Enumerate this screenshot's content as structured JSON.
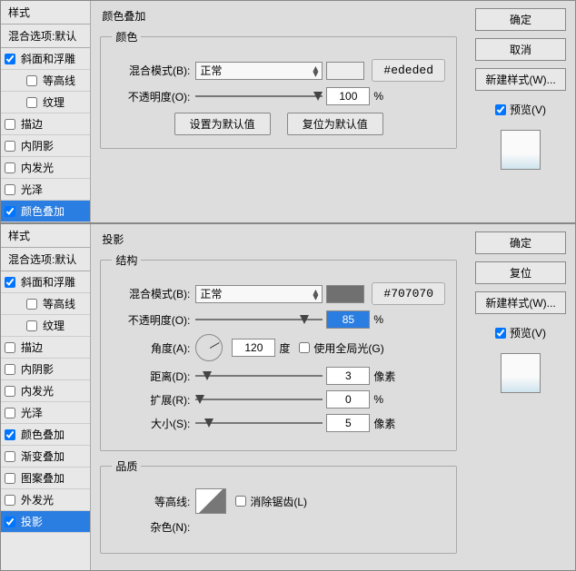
{
  "top": {
    "sidebar": {
      "header": "样式",
      "sub": "混合选项:默认",
      "items": [
        {
          "label": "斜面和浮雕",
          "checked": true,
          "indent": false
        },
        {
          "label": "等高线",
          "checked": false,
          "indent": true
        },
        {
          "label": "纹理",
          "checked": false,
          "indent": true
        },
        {
          "label": "描边",
          "checked": false,
          "indent": false
        },
        {
          "label": "内阴影",
          "checked": false,
          "indent": false
        },
        {
          "label": "内发光",
          "checked": false,
          "indent": false
        },
        {
          "label": "光泽",
          "checked": false,
          "indent": false
        },
        {
          "label": "颜色叠加",
          "checked": true,
          "indent": false,
          "selected": true
        }
      ]
    },
    "main": {
      "title": "颜色叠加",
      "group": "颜色",
      "blend_label": "混合模式(B):",
      "blend_value": "正常",
      "color_hex": "#ededed",
      "opacity_label": "不透明度(O):",
      "opacity_value": "100",
      "opacity_unit": "%",
      "btn_default": "设置为默认值",
      "btn_reset": "复位为默认值"
    },
    "right": {
      "ok": "确定",
      "cancel": "取消",
      "newstyle": "新建样式(W)...",
      "preview": "预览(V)"
    }
  },
  "bottom": {
    "sidebar": {
      "header": "样式",
      "sub": "混合选项:默认",
      "items": [
        {
          "label": "斜面和浮雕",
          "checked": true,
          "indent": false
        },
        {
          "label": "等高线",
          "checked": false,
          "indent": true
        },
        {
          "label": "纹理",
          "checked": false,
          "indent": true
        },
        {
          "label": "描边",
          "checked": false,
          "indent": false
        },
        {
          "label": "内阴影",
          "checked": false,
          "indent": false
        },
        {
          "label": "内发光",
          "checked": false,
          "indent": false
        },
        {
          "label": "光泽",
          "checked": false,
          "indent": false
        },
        {
          "label": "颜色叠加",
          "checked": true,
          "indent": false
        },
        {
          "label": "渐变叠加",
          "checked": false,
          "indent": false
        },
        {
          "label": "图案叠加",
          "checked": false,
          "indent": false
        },
        {
          "label": "外发光",
          "checked": false,
          "indent": false
        },
        {
          "label": "投影",
          "checked": true,
          "indent": false,
          "selected": true
        }
      ]
    },
    "main": {
      "title": "投影",
      "group1": "结构",
      "blend_label": "混合模式(B):",
      "blend_value": "正常",
      "color_hex": "#707070",
      "swatch_color": "#707070",
      "opacity_label": "不透明度(O):",
      "opacity_value": "85",
      "opacity_unit": "%",
      "angle_label": "角度(A):",
      "angle_value": "120",
      "angle_unit": "度",
      "global_light": "使用全局光(G)",
      "distance_label": "距离(D):",
      "distance_value": "3",
      "distance_unit": "像素",
      "spread_label": "扩展(R):",
      "spread_value": "0",
      "spread_unit": "%",
      "size_label": "大小(S):",
      "size_value": "5",
      "size_unit": "像素",
      "group2": "品质",
      "contour_label": "等高线:",
      "antialiase": "消除锯齿(L)",
      "noise_label": "杂色(N):"
    },
    "right": {
      "ok": "确定",
      "reset": "复位",
      "newstyle": "新建样式(W)...",
      "preview": "预览(V)"
    }
  }
}
